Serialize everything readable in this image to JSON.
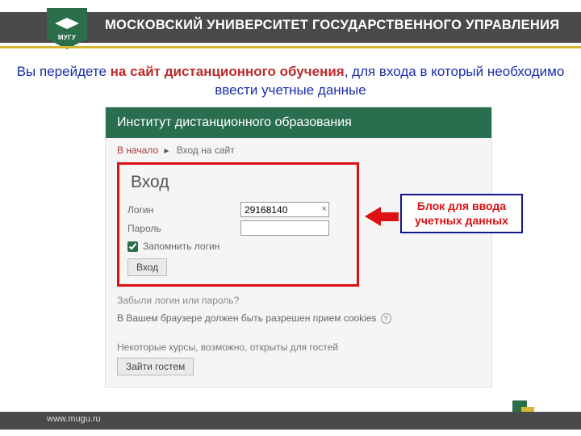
{
  "header": {
    "brand": "МУГУ",
    "title": "МОСКОВСКИЙ УНИВЕРСИТЕТ ГОСУДАРСТВЕННОГО УПРАВЛЕНИЯ"
  },
  "instruction": {
    "pre": "Вы перейдете ",
    "bold": "на сайт дистанционного обучения",
    "post": ", для входа в который необходимо ввести учетные данные"
  },
  "panel": {
    "title": "Институт дистанционного образования",
    "breadcrumb": {
      "home": "В начало",
      "sep": "►",
      "current": "Вход на сайт"
    },
    "login": {
      "heading": "Вход",
      "login_label": "Логин",
      "login_value": "29168140",
      "password_label": "Пароль",
      "password_value": "",
      "remember_label": "Запомнить логин",
      "remember_checked": true,
      "submit_label": "Вход"
    },
    "forgot_label": "Забыли логин или пароль?",
    "cookies_text": "В Вашем браузере должен быть разрешен прием cookies",
    "guest_text": "Некоторые курсы, возможно, открыты для гостей",
    "guest_button": "Зайти гостем"
  },
  "callout": {
    "text": "Блок для ввода учетных данных"
  },
  "footer": {
    "url": "www.mugu.ru"
  }
}
